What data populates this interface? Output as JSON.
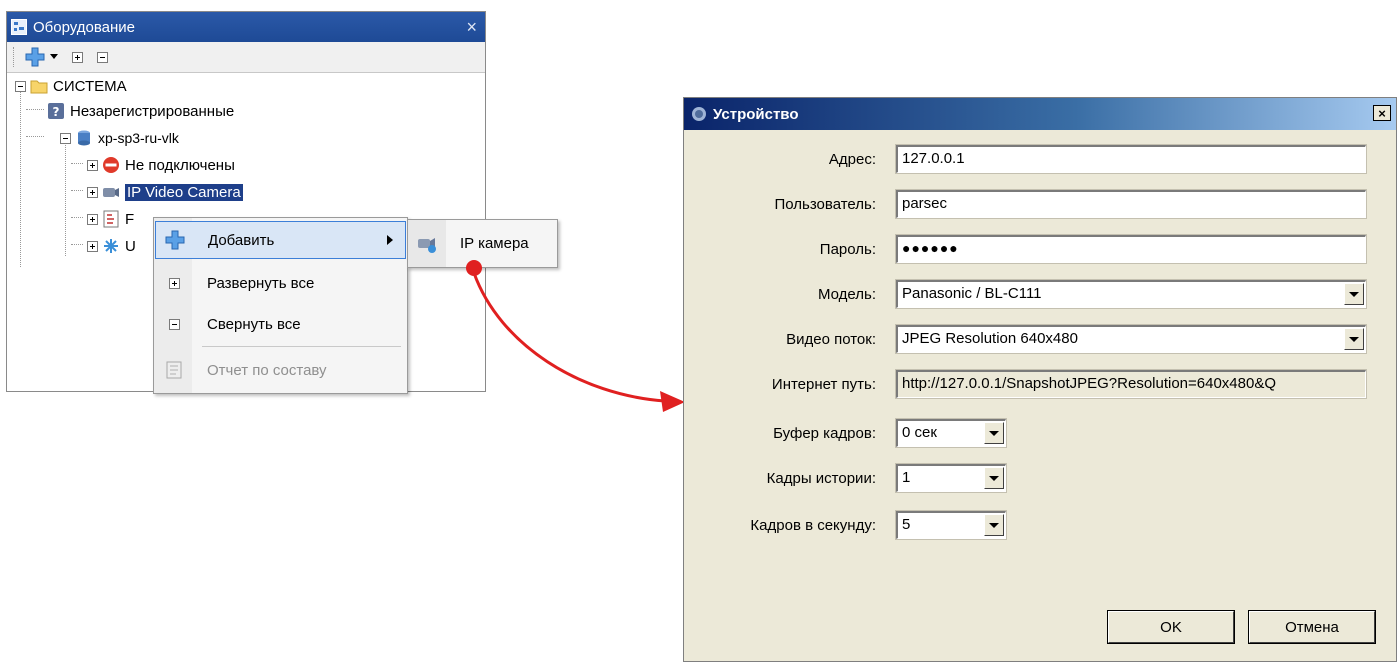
{
  "equipment_panel": {
    "title": "Оборудование",
    "close_glyph": "×",
    "tree": {
      "root": "СИСТЕМА",
      "unregistered": "Незарегистрированные",
      "server": "xp-sp3-ru-vlk",
      "not_connected": "Не подключены",
      "ip_video": "IP Video Camera",
      "item_f": "F",
      "item_u": "U"
    }
  },
  "context_menu": {
    "add": "Добавить",
    "expand_all": "Развернуть все",
    "collapse_all": "Свернуть все",
    "report": "Отчет по составу"
  },
  "submenu": {
    "ip_camera": "IP камера"
  },
  "dialog": {
    "title": "Устройство",
    "close_glyph": "×",
    "address_label": "Адрес:",
    "address_value": "127.0.0.1",
    "user_label": "Пользователь:",
    "user_value": "parsec",
    "password_label": "Пароль:",
    "password_value": "●●●●●●",
    "model_label": "Модель:",
    "model_value": "Panasonic / BL-C111",
    "stream_label": "Видео поток:",
    "stream_value": "JPEG Resolution 640x480",
    "url_label": "Интернет путь:",
    "url_value": "http://127.0.0.1/SnapshotJPEG?Resolution=640x480&Q",
    "buffer_label": "Буфер кадров:",
    "buffer_value": "0 сек",
    "history_label": "Кадры истории:",
    "history_value": "1",
    "fps_label": "Кадров в секунду:",
    "fps_value": "5",
    "ok_label": "OK",
    "cancel_label": "Отмена"
  },
  "colors": {
    "title_bar": "#2b59a8",
    "highlight": "#d9e6f6",
    "arrow": "#e02020"
  }
}
